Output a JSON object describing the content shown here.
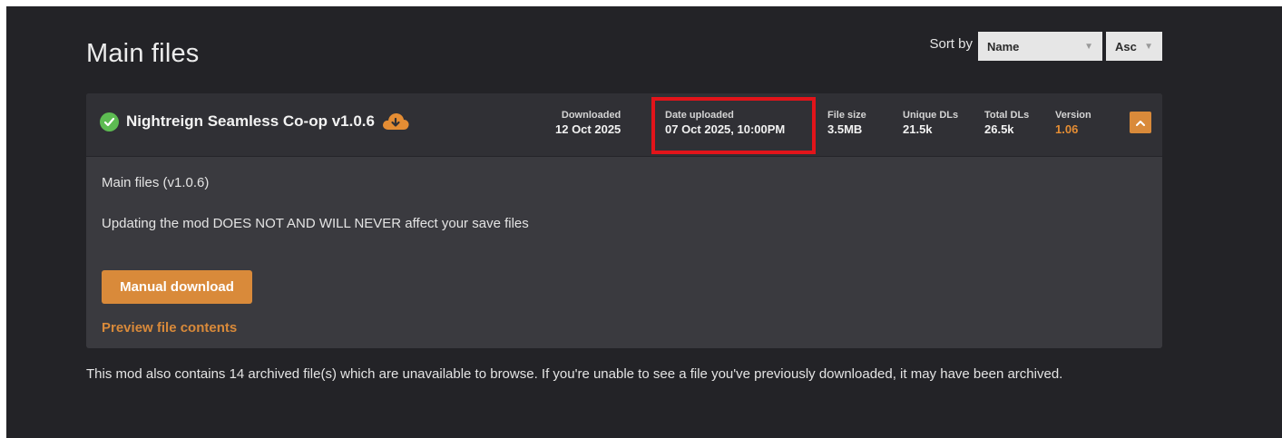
{
  "section": {
    "title": "Main files",
    "sort_label": "Sort by",
    "sort_field": "Name",
    "sort_order": "Asc"
  },
  "file": {
    "name": "Nightreign Seamless Co-op v1.0.6",
    "status_icon": "check-circle-icon",
    "download_icon": "cloud-download-icon",
    "stats": {
      "downloaded_label": "Downloaded",
      "downloaded_value": "12 Oct 2025",
      "uploaded_label": "Date uploaded",
      "uploaded_value": "07 Oct 2025, 10:00PM",
      "size_label": "File size",
      "size_value": "3.5MB",
      "unique_label": "Unique DLs",
      "unique_value": "21.5k",
      "total_label": "Total DLs",
      "total_value": "26.5k",
      "version_label": "Version",
      "version_value": "1.06"
    },
    "description_title": "Main files (v1.0.6)",
    "description_text": "Updating the mod DOES NOT AND WILL NEVER affect your save files",
    "manual_download_label": "Manual download",
    "preview_label": "Preview file contents"
  },
  "footer": {
    "note": "This mod also contains 14 archived file(s) which are unavailable to browse. If you're unable to see a file you've previously downloaded, it may have been archived."
  },
  "colors": {
    "accent": "#d98a3a",
    "highlight_border": "#e2141a",
    "success": "#5dbb52",
    "background": "#232327",
    "card": "#3a3a3f"
  }
}
